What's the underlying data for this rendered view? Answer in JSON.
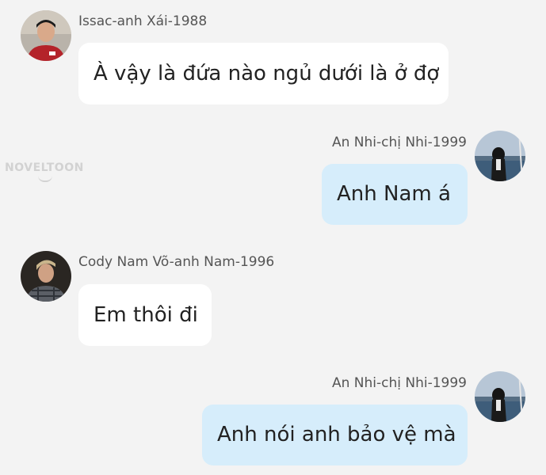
{
  "watermark": {
    "text": "NOVELTOON"
  },
  "messages": [
    {
      "sender": "Issac-anh Xái-1988",
      "text": "À vậy là đứa nào ngủ dưới là ở đợ",
      "side": "left",
      "avatar_icon": "male-avatar-red-shirt"
    },
    {
      "sender": "An Nhi-chị Nhi-1999",
      "text": "Anh Nam á",
      "side": "right",
      "avatar_icon": "female-avatar-seaside"
    },
    {
      "sender": "Cody Nam Võ-anh Nam-1996",
      "text": "Em thôi đi",
      "side": "left",
      "avatar_icon": "male-avatar-plaid-shirt"
    },
    {
      "sender": "An Nhi-chị Nhi-1999",
      "text": "Anh nói anh bảo vệ mà",
      "side": "right",
      "avatar_icon": "female-avatar-seaside"
    }
  ],
  "colors": {
    "background": "#f3f3f3",
    "left_bubble": "#ffffff",
    "right_bubble": "#d6edfb",
    "name_text": "#555555",
    "message_text": "#222222"
  }
}
